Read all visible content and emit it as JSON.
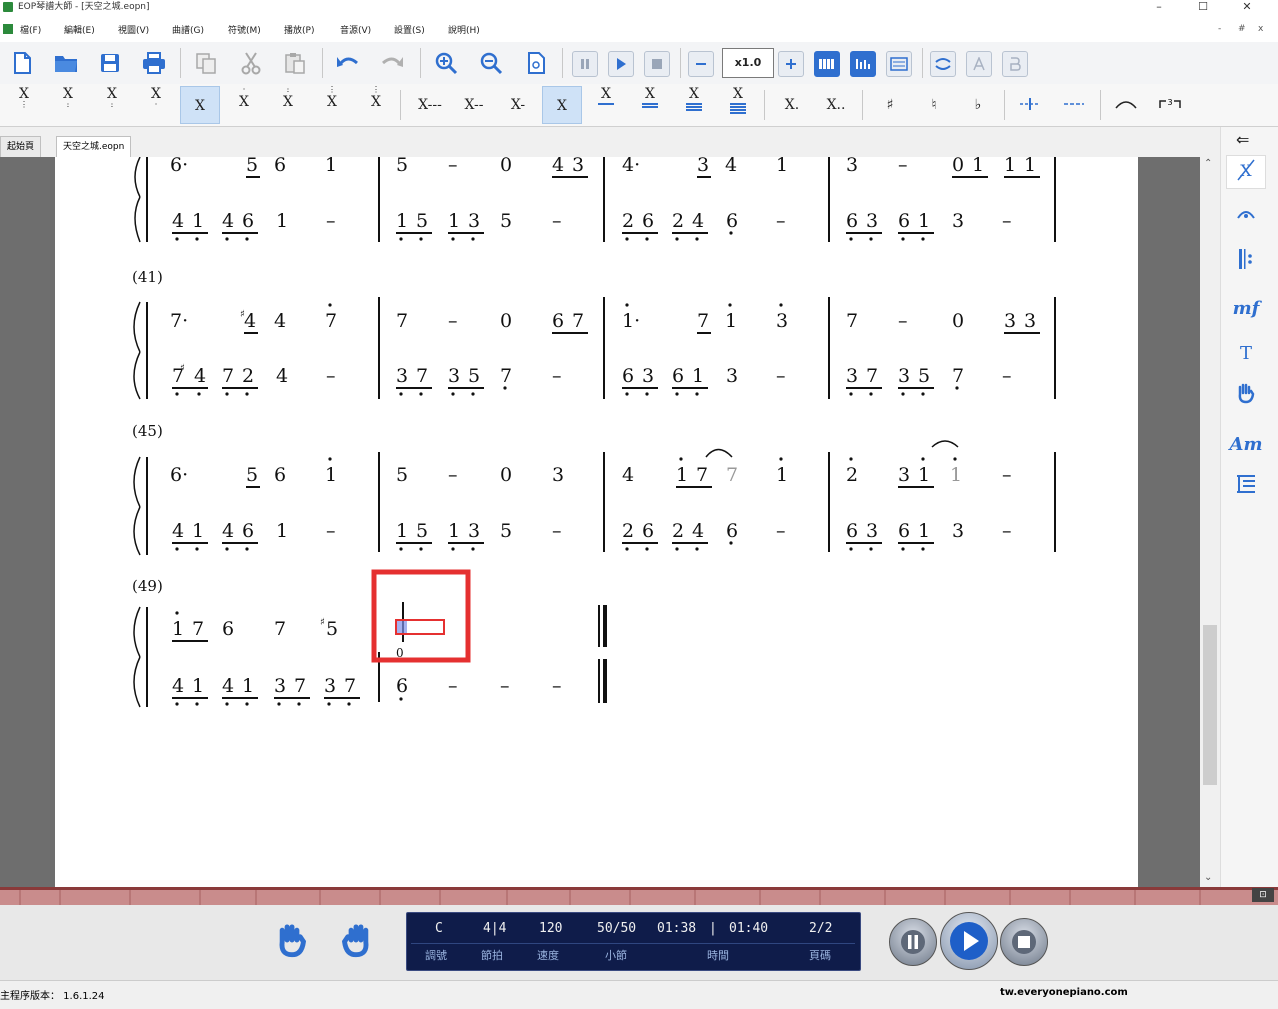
{
  "window": {
    "title": "EOP琴譜大師 - [天空之城.eopn]",
    "minimize": "–",
    "maximize": "☐",
    "close": "✕"
  },
  "menu": {
    "items": [
      "檔(F)",
      "編輯(E)",
      "視圖(V)",
      "曲譜(G)",
      "符號(M)",
      "播放(P)",
      "音源(V)",
      "設置(S)",
      "說明(H)"
    ],
    "mdi_controls": [
      "-",
      "#",
      "x"
    ]
  },
  "toolbar": {
    "speed": "x1.0"
  },
  "notebar": {
    "dur_buttons": [
      "X",
      "X",
      "X",
      "X",
      "X",
      "X",
      "X",
      "X",
      "X"
    ],
    "len_buttons": [
      "X---",
      "X--",
      "X-",
      "X",
      "X",
      "X",
      "X",
      "X"
    ],
    "dot_buttons": [
      "X.",
      "X.."
    ],
    "accidentals": [
      "♯",
      "♮",
      "♭"
    ]
  },
  "tabs": [
    "起始頁",
    "天空之城.eopn"
  ],
  "right_panel": {
    "dynamic": "mf",
    "text": "T",
    "chord": "Am"
  },
  "score": {
    "measure_labels": [
      "(41)",
      "(45)",
      "(49)"
    ]
  },
  "display": {
    "key": "C",
    "meter": "4|4",
    "tempo": "120",
    "bar": "50/50",
    "time_cur": "01:38",
    "time_total": "01:40",
    "page": "2/2",
    "labels": [
      "調號",
      "節拍",
      "速度",
      "小節",
      "時間",
      "頁碼"
    ]
  },
  "status": {
    "version": "主程序版本： 1.6.1.24",
    "site": "tw.everyonepiano.com"
  },
  "colors": {
    "accent": "#2f6fcf",
    "highlight": "#e53030",
    "display_bg": "#0f1c4a"
  }
}
